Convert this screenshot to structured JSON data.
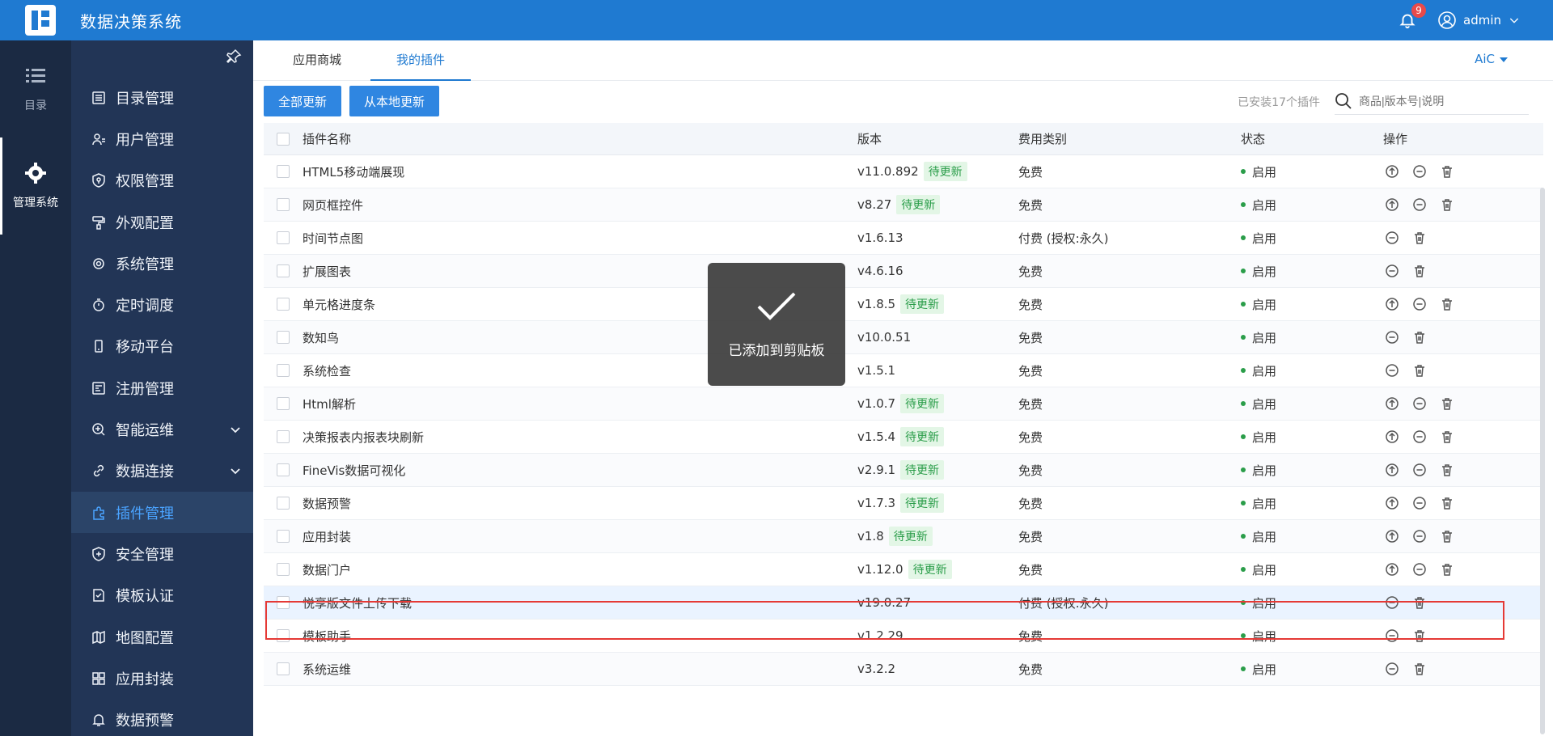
{
  "app": {
    "title": "数据决策系统",
    "notifications": "9",
    "user": "admin"
  },
  "leftnav": [
    {
      "label": "目录",
      "icon": "list-icon"
    },
    {
      "label": "管理系统",
      "icon": "gear-icon"
    }
  ],
  "menu": [
    {
      "label": "目录管理",
      "icon": "catalog-icon"
    },
    {
      "label": "用户管理",
      "icon": "user-icon"
    },
    {
      "label": "权限管理",
      "icon": "shield-lock-icon"
    },
    {
      "label": "外观配置",
      "icon": "paint-roller-icon"
    },
    {
      "label": "系统管理",
      "icon": "settings-icon"
    },
    {
      "label": "定时调度",
      "icon": "timer-icon"
    },
    {
      "label": "移动平台",
      "icon": "mobile-icon"
    },
    {
      "label": "注册管理",
      "icon": "register-icon"
    },
    {
      "label": "智能运维",
      "icon": "ops-icon",
      "expandable": true
    },
    {
      "label": "数据连接",
      "icon": "link-icon",
      "expandable": true
    },
    {
      "label": "插件管理",
      "icon": "plugin-icon",
      "active": true
    },
    {
      "label": "安全管理",
      "icon": "security-icon"
    },
    {
      "label": "模板认证",
      "icon": "template-icon"
    },
    {
      "label": "地图配置",
      "icon": "map-icon"
    },
    {
      "label": "应用封装",
      "icon": "app-icon"
    },
    {
      "label": "数据预警",
      "icon": "alert-bell-icon"
    }
  ],
  "tabs": [
    "应用商城",
    "我的插件"
  ],
  "active_tab": 1,
  "aic": "AiC",
  "buttons": {
    "update_all": "全部更新",
    "update_local": "从本地更新"
  },
  "installed_text": "已安装17个插件",
  "search_placeholder": "商品|版本号|说明",
  "columns": {
    "name": "插件名称",
    "version": "版本",
    "fee": "费用类别",
    "status": "状态",
    "ops": "操作"
  },
  "update_tag": "待更新",
  "status_enabled": "启用",
  "rows": [
    {
      "name": "HTML5移动端展现",
      "version": "v11.0.892",
      "update": true,
      "fee": "免费"
    },
    {
      "name": "网页框控件",
      "version": "v8.27",
      "update": true,
      "fee": "免费"
    },
    {
      "name": "时间节点图",
      "version": "v1.6.13",
      "update": false,
      "fee": "付费 (授权:永久)"
    },
    {
      "name": "扩展图表",
      "version": "v4.6.16",
      "update": false,
      "fee": "免费"
    },
    {
      "name": "单元格进度条",
      "version": "v1.8.5",
      "update": true,
      "fee": "免费"
    },
    {
      "name": "数知鸟",
      "version": "v10.0.51",
      "update": false,
      "fee": "免费"
    },
    {
      "name": "系统检查",
      "version": "v1.5.1",
      "update": false,
      "fee": "免费"
    },
    {
      "name": "Html解析",
      "version": "v1.0.7",
      "update": true,
      "fee": "免费"
    },
    {
      "name": "决策报表内报表块刷新",
      "version": "v1.5.4",
      "update": true,
      "fee": "免费"
    },
    {
      "name": "FineVis数据可视化",
      "version": "v2.9.1",
      "update": true,
      "fee": "免费"
    },
    {
      "name": "数据预警",
      "version": "v1.7.3",
      "update": true,
      "fee": "免费"
    },
    {
      "name": "应用封装",
      "version": "v1.8",
      "update": true,
      "fee": "免费"
    },
    {
      "name": "数据门户",
      "version": "v1.12.0",
      "update": true,
      "fee": "免费"
    },
    {
      "name": "悦享版文件上传下载",
      "version": "v19.0.27",
      "update": false,
      "fee": "付费 (授权:永久)",
      "highlight": true
    },
    {
      "name": "模板助手",
      "version": "v1.2.29",
      "update": false,
      "fee": "免费"
    },
    {
      "name": "系统运维",
      "version": "v3.2.2",
      "update": false,
      "fee": "免费"
    }
  ],
  "toast": "已添加到剪贴板"
}
